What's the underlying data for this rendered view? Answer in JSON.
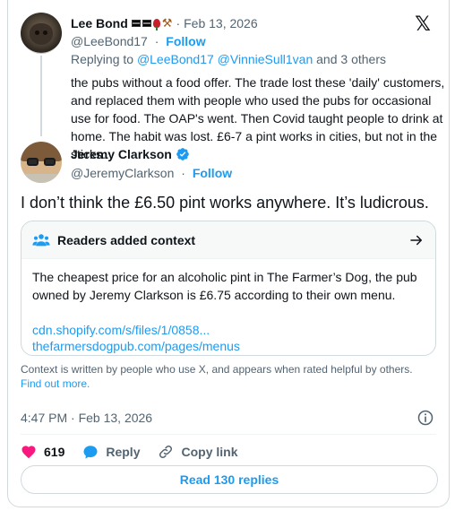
{
  "parent": {
    "name": "Lee Bond",
    "name_emoji": [
      "flag",
      "rose",
      "hammers"
    ],
    "date": "Feb 13, 2026",
    "handle": "@LeeBond17",
    "follow_label": "Follow",
    "replying_prefix": "Replying to",
    "replying_handles": "@LeeBond17 @VinnieSull1van",
    "replying_suffix": "and 3 others",
    "text": "the pubs without a food offer. The trade lost these 'daily' customers, and replaced them with people who used the pubs for occasional use for food. The OAP's went. Then Covid taught people to drink at home. The habit was lost. £6-7 a pint works in cities, but not in the sticks.."
  },
  "main": {
    "name": "Jeremy Clarkson",
    "verified": true,
    "handle": "@JeremyClarkson",
    "follow_label": "Follow",
    "text": "I don’t think the £6.50 pint works anywhere. It’s ludicrous."
  },
  "note": {
    "title": "Readers added context",
    "body": "The cheapest price for an alcoholic pint in The Farmer’s Dog, the pub owned by Jeremy Clarkson is £6.75 according to their own menu.",
    "links": [
      "cdn.shopify.com/s/files/1/0858...",
      "thefarmersdogpub.com/pages/menus"
    ],
    "footer_text": "Context is written by people who use X, and appears when rated helpful by others.",
    "footer_link": "Find out more."
  },
  "timestamp": "4:47 PM · Feb 13, 2026",
  "actions": {
    "like_count": "619",
    "reply_label": "Reply",
    "copy_label": "Copy link"
  },
  "read_replies_label": "Read 130 replies",
  "colors": {
    "accent": "#1d9bf0",
    "like": "#f91880",
    "border": "#cfd9de",
    "muted": "#536471"
  },
  "icons": [
    "x-logo-icon",
    "verified-icon",
    "people-icon",
    "arrow-right-icon",
    "info-icon",
    "heart-icon",
    "reply-bubble-icon",
    "link-icon"
  ]
}
